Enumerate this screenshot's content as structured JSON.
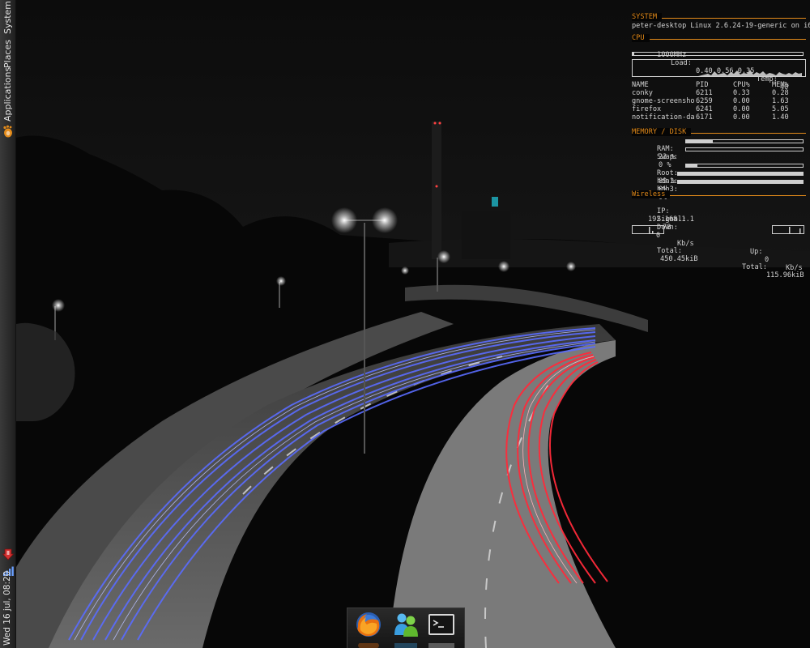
{
  "panel": {
    "menus": [
      "Applications",
      "Places",
      "System"
    ],
    "clock": "Wed 16 jul, 08:20"
  },
  "conky": {
    "system": {
      "title": "SYSTEM",
      "line": "peter-desktop Linux 2.6.24-19-generic on i686"
    },
    "cpu": {
      "title": "CPU",
      "freq": "1000MHz",
      "load_label": "Load:",
      "load": "0.40 0.56 0.35",
      "temp_label": "Temp:",
      "temp": "40",
      "headers": [
        "NAME",
        "PID",
        "CPU%",
        "MEM%"
      ],
      "processes": [
        {
          "name": "conky",
          "pid": "6211",
          "cpu": "0.33",
          "mem": "0.28"
        },
        {
          "name": "gnome-screensho",
          "pid": "6259",
          "cpu": "0.00",
          "mem": "1.63"
        },
        {
          "name": "firefox",
          "pid": "6241",
          "cpu": "0.00",
          "mem": "5.05"
        },
        {
          "name": "notification-da",
          "pid": "6171",
          "cpu": "0.00",
          "mem": "1.40"
        }
      ]
    },
    "memory": {
      "title": "MEMORY / DISK",
      "items": [
        {
          "label": "RAM:",
          "value": "23 %",
          "fraction": 0.23
        },
        {
          "label": "Swap:",
          "value": "0 %",
          "fraction": 0.0
        },
        {
          "label": "Root:",
          "value": "89 %",
          "fraction": 0.1
        },
        {
          "label": "hda1:",
          "value": "0%",
          "fraction": 1.0
        },
        {
          "label": "hdb3:",
          "value": "0%",
          "fraction": 1.0
        }
      ]
    },
    "wireless": {
      "title": "Wireless",
      "ip_label": "IP:",
      "ip": "192.168.1.1",
      "signal_label": "Signal:",
      "signal": "78",
      "down_label": "Down:",
      "down": "0",
      "up_label": "Up:",
      "up": "0",
      "unit": "Kb/s",
      "total_label": "Total:",
      "total_down": "450.45kiB",
      "total_up": "115.96kiB"
    }
  },
  "dock": {
    "items": [
      "firefox-icon",
      "messenger-icon",
      "terminal-icon"
    ]
  },
  "colors": {
    "accent": "#e48b1a",
    "text": "#d2d2d2",
    "light_trail_blue": "#5a6cff",
    "light_trail_red": "#ff2a3a"
  }
}
